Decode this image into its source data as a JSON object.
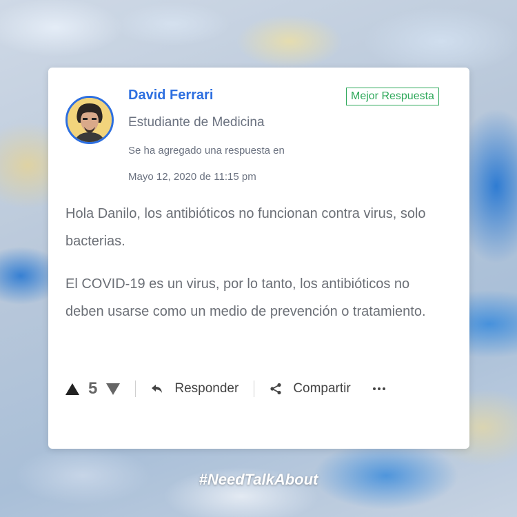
{
  "post": {
    "author_name": "David Ferrari",
    "author_role": "Estudiante de Medicina",
    "badge": "Mejor Respuesta",
    "meta_line1": "Se ha agregado una respuesta en",
    "meta_line2": "Mayo 12, 2020 de 11:15 pm",
    "paragraphs": [
      "Hola Danilo, los antibióticos no funcionan contra virus, solo bacterias.",
      "El COVID-19 es un virus, por lo tanto, los antibióticos no deben usarse como un medio de prevención o tratamiento."
    ]
  },
  "actions": {
    "upvote_icon": "triangle-up-icon",
    "vote_count": "5",
    "downvote_icon": "triangle-down-icon",
    "reply_icon": "reply-arrow-icon",
    "reply_label": "Responder",
    "share_icon": "share-icon",
    "share_label": "Compartir",
    "more_icon": "ellipsis-icon"
  },
  "hashtag": "#NeedTalkAbout",
  "colors": {
    "accent": "#2d6fe0",
    "badge": "#2ea85a",
    "text_muted": "#6b7280",
    "body_text": "#6b6f76"
  }
}
